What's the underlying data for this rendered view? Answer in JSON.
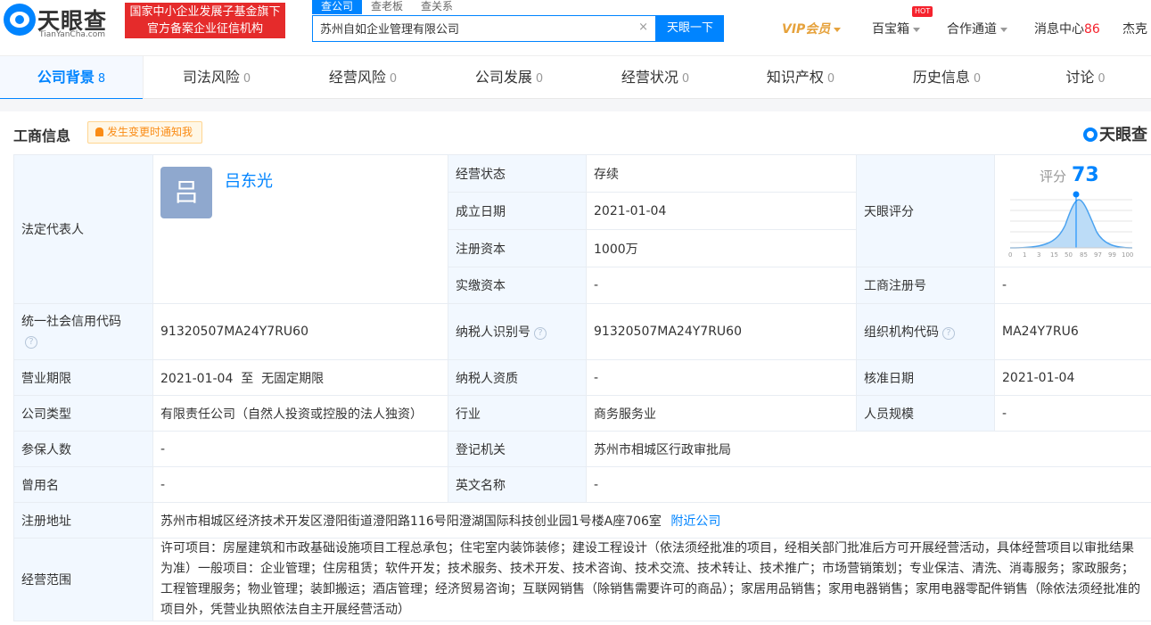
{
  "brand": {
    "name_cn": "天眼查",
    "name_en": "TianYanCha.com",
    "slogan_line1": "国家中小企业发展子基金旗下",
    "slogan_line2": "官方备案企业征信机构"
  },
  "search": {
    "tabs": [
      "查公司",
      "查老板",
      "查关系"
    ],
    "active_tab": 0,
    "value": "苏州自如企业管理有限公司",
    "clear": "×",
    "button": "天眼一下"
  },
  "topnav": {
    "vip": "VIP会员",
    "treasure": "百宝箱",
    "hot": "HOT",
    "cooperate": "合作通道",
    "messages": "消息中心",
    "message_count": "86",
    "user": "杰克"
  },
  "tabs": [
    {
      "label": "公司背景",
      "count": "8"
    },
    {
      "label": "司法风险",
      "count": "0"
    },
    {
      "label": "经营风险",
      "count": "0"
    },
    {
      "label": "公司发展",
      "count": "0"
    },
    {
      "label": "经营状况",
      "count": "0"
    },
    {
      "label": "知识产权",
      "count": "0"
    },
    {
      "label": "历史信息",
      "count": "0"
    },
    {
      "label": "讨论",
      "count": "0"
    }
  ],
  "section": {
    "title": "工商信息",
    "notify": "发生变更时通知我",
    "brand": "天眼查"
  },
  "info": {
    "legal_rep_label": "法定代表人",
    "legal_rep_avatar": "吕",
    "legal_rep_name": "吕东光",
    "status_label": "经营状态",
    "status": "存续",
    "established_label": "成立日期",
    "established": "2021-01-04",
    "reg_capital_label": "注册资本",
    "reg_capital": "1000万",
    "paid_capital_label": "实缴资本",
    "paid_capital": "-",
    "score_label": "天眼评分",
    "score_text": "评分",
    "score_value": "73",
    "score_ticks": [
      "0",
      "1",
      "3",
      "15",
      "50",
      "85",
      "97",
      "99",
      "100"
    ],
    "reg_no_label": "工商注册号",
    "reg_no": "-",
    "credit_code_label": "统一社会信用代码",
    "credit_code": "91320507MA24Y7RU60",
    "taxpayer_id_label": "纳税人识别号",
    "taxpayer_id": "91320507MA24Y7RU60",
    "org_code_label": "组织机构代码",
    "org_code": "MA24Y7RU6",
    "term_label": "营业期限",
    "term": "2021-01-04  至  无固定期限",
    "taxpayer_qual_label": "纳税人资质",
    "taxpayer_qual": "-",
    "approve_date_label": "核准日期",
    "approve_date": "2021-01-04",
    "company_type_label": "公司类型",
    "company_type": "有限责任公司（自然人投资或控股的法人独资）",
    "industry_label": "行业",
    "industry": "商务服务业",
    "staff_size_label": "人员规模",
    "staff_size": "-",
    "insured_label": "参保人数",
    "insured": "-",
    "reg_authority_label": "登记机关",
    "reg_authority": "苏州市相城区行政审批局",
    "former_name_label": "曾用名",
    "former_name": "-",
    "english_name_label": "英文名称",
    "english_name": "-",
    "address_label": "注册地址",
    "address": "苏州市相城区经济技术开发区澄阳街道澄阳路116号阳澄湖国际科技创业园1号楼A座706室",
    "nearby": "附近公司",
    "scope_label": "经营范围",
    "scope": "许可项目：房屋建筑和市政基础设施项目工程总承包；住宅室内装饰装修；建设工程设计（依法须经批准的项目，经相关部门批准后方可开展经营活动，具体经营项目以审批结果为准）一般项目：企业管理；住房租赁；软件开发；技术服务、技术开发、技术咨询、技术交流、技术转让、技术推广；市场营销策划；专业保洁、清洗、消毒服务；家政服务；工程管理服务；物业管理；装卸搬运；酒店管理；经济贸易咨询；互联网销售（除销售需要许可的商品）；家居用品销售；家用电器销售；家用电器零配件销售（除依法须经批准的项目外，凭营业执照依法自主开展经营活动）"
  },
  "colors": {
    "primary": "#0084ff",
    "label_bg": "#f2f8ff",
    "slogan_bg": "#e52b2b",
    "vip": "#e6a23c"
  }
}
